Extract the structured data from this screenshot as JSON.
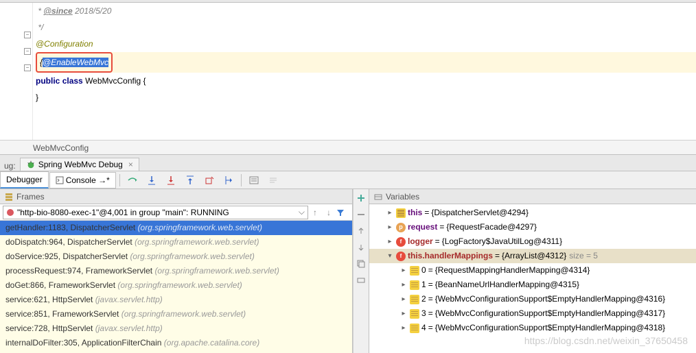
{
  "editor": {
    "lines": {
      "l1": " * @since 2018/5/20",
      "l2": " */",
      "l3": "@Configuration",
      "l4_caret": "{",
      "l4_sel": "@EnableWebMvc",
      "l5_kw1": "public",
      "l5_kw2": "class",
      "l5_name": "WebMvcConfig",
      "l5_brace": "{",
      "l6": "}"
    }
  },
  "breadcrumb": "WebMvcConfig",
  "debug_session": {
    "label": "Spring WebMvc Debug"
  },
  "toolbar_tabs": {
    "debugger": "Debugger",
    "console": "Console →*"
  },
  "frames": {
    "title": "Frames",
    "thread": "\"http-bio-8080-exec-1\"@4,001 in group \"main\": RUNNING",
    "items": [
      {
        "method": "getHandler:1183, DispatcherServlet",
        "pkg": "(org.springframework.web.servlet)",
        "selected": true
      },
      {
        "method": "doDispatch:964, DispatcherServlet",
        "pkg": "(org.springframework.web.servlet)"
      },
      {
        "method": "doService:925, DispatcherServlet",
        "pkg": "(org.springframework.web.servlet)"
      },
      {
        "method": "processRequest:974, FrameworkServlet",
        "pkg": "(org.springframework.web.servlet)"
      },
      {
        "method": "doGet:866, FrameworkServlet",
        "pkg": "(org.springframework.web.servlet)"
      },
      {
        "method": "service:621, HttpServlet",
        "pkg": "(javax.servlet.http)"
      },
      {
        "method": "service:851, FrameworkServlet",
        "pkg": "(org.springframework.web.servlet)"
      },
      {
        "method": "service:728, HttpServlet",
        "pkg": "(javax.servlet.http)"
      },
      {
        "method": "internalDoFilter:305, ApplicationFilterChain",
        "pkg": "(org.apache.catalina.core)"
      }
    ]
  },
  "ug_label": "ug:",
  "variables": {
    "title": "Variables",
    "items": [
      {
        "expander": "▸",
        "icon": "obj",
        "name": "this",
        "val": "{DispatcherServlet@4294}",
        "indent": 1
      },
      {
        "expander": "▸",
        "icon": "p",
        "name": "request",
        "val": "{RequestFacade@4297}",
        "indent": 1
      },
      {
        "expander": "▸",
        "icon": "f",
        "name": "logger",
        "val": "{LogFactory$JavaUtilLog@4311}",
        "indent": 1,
        "red": true
      },
      {
        "expander": "▾",
        "icon": "f",
        "name": "this.handlerMappings",
        "val": "{ArrayList@4312}",
        "size": "size = 5",
        "indent": 1,
        "red": true,
        "selected": true
      },
      {
        "expander": "▸",
        "icon": "arr",
        "name": "0",
        "val": "{RequestMappingHandlerMapping@4314}",
        "indent": 2
      },
      {
        "expander": "▸",
        "icon": "arr",
        "name": "1",
        "val": "{BeanNameUrlHandlerMapping@4315}",
        "indent": 2
      },
      {
        "expander": "▸",
        "icon": "arr",
        "name": "2",
        "val": "{WebMvcConfigurationSupport$EmptyHandlerMapping@4316}",
        "indent": 2
      },
      {
        "expander": "▸",
        "icon": "arr",
        "name": "3",
        "val": "{WebMvcConfigurationSupport$EmptyHandlerMapping@4317}",
        "indent": 2
      },
      {
        "expander": "▸",
        "icon": "arr",
        "name": "4",
        "val": "{WebMvcConfigurationSupport$EmptyHandlerMapping@4318}",
        "indent": 2
      }
    ]
  },
  "watermark": "https://blog.csdn.net/weixin_37650458"
}
